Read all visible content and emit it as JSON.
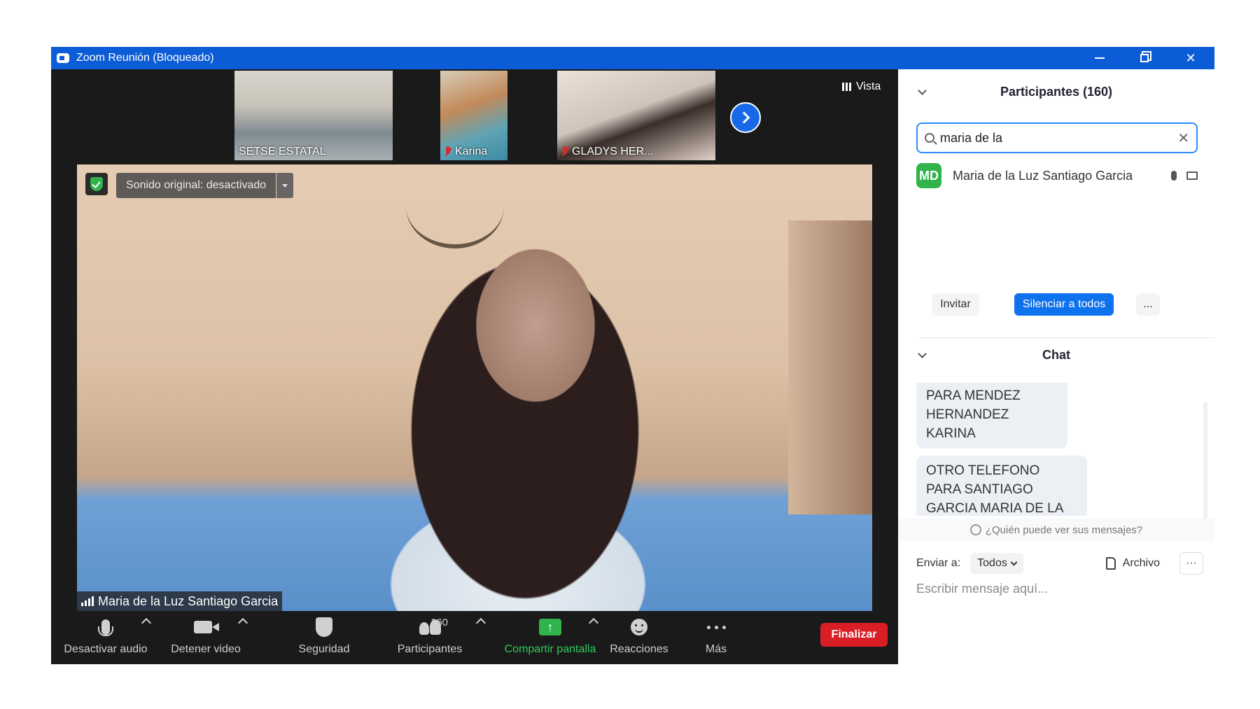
{
  "window": {
    "title": "Zoom Reunión (Bloqueado)",
    "minimize": "",
    "restore": "",
    "close": "✕"
  },
  "gallery": {
    "view_label": "Vista",
    "thumbnails": [
      {
        "name": "SETSE ESTATAL",
        "muted": false
      },
      {
        "name": "Karina",
        "muted": true
      },
      {
        "name": "GLADYS HER...",
        "muted": true
      }
    ]
  },
  "main_video": {
    "sound_label": "Sonido original: desactivado",
    "speaker_name": "Maria de la Luz Santiago Garcia"
  },
  "toolbar": {
    "audio": "Desactivar audio",
    "video": "Detener video",
    "security": "Seguridad",
    "participants": "Participantes",
    "participants_count": "160",
    "share": "Compartir pantalla",
    "reactions": "Reacciones",
    "more": "Más",
    "end": "Finalizar"
  },
  "participants_panel": {
    "header": "Participantes (160)",
    "search_value": "maria de la",
    "results": [
      {
        "initials": "MD",
        "name": "Maria de la Luz Santiago Garcia"
      }
    ],
    "invite": "Invitar",
    "mute_all": "Silenciar a todos",
    "more": "..."
  },
  "chat_panel": {
    "header": "Chat",
    "messages": [
      "OTRO TELEFONO PARA MENDEZ HERNANDEZ KARINA",
      "OTRO TELEFONO PARA SANTIAGO GARCIA MARIA DE LA LUZ"
    ],
    "who_can_see": "¿Quién puede ver sus mensajes?",
    "send_to_label": "Enviar a:",
    "send_to_value": "Todos",
    "file": "Archivo",
    "more": "···",
    "input_placeholder": "Escribir mensaje aquí..."
  },
  "colors": {
    "titlebar": "#0b5cd6",
    "accent": "#0e72ed",
    "end_button": "#d91e25",
    "share_green": "#2fb34a"
  }
}
